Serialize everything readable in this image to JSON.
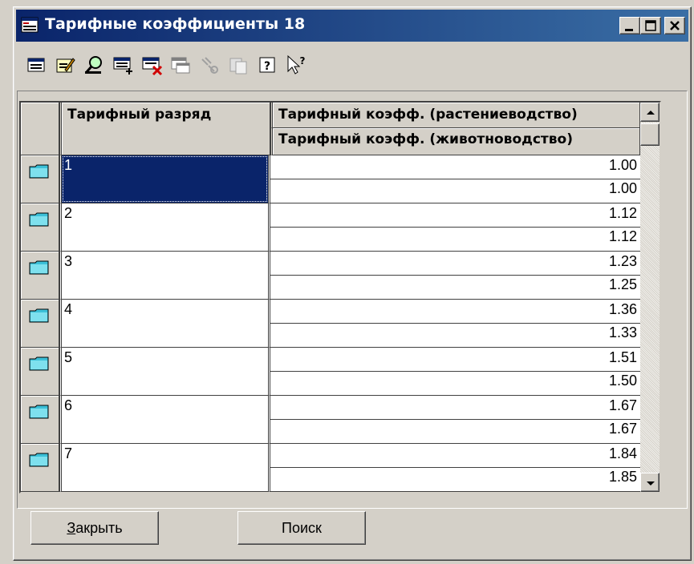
{
  "window": {
    "title": "Тарифные коэффициенты 18"
  },
  "toolbar": {
    "icons": [
      "record-icon",
      "edit-icon",
      "find-icon",
      "add-record-icon",
      "delete-record-icon",
      "copy-record-icon",
      "disabled-link-icon",
      "disabled-paste-icon",
      "help-icon",
      "context-help-icon"
    ]
  },
  "grid": {
    "columns": {
      "rank": "Тарифный разряд",
      "coef_crop": "Тарифный коэфф. (растениеводство)",
      "coef_livestock": "Тарифный коэфф. (животноводство)"
    },
    "rows": [
      {
        "rank": "1",
        "crop": "1.00",
        "livestock": "1.00",
        "selected": true
      },
      {
        "rank": "2",
        "crop": "1.12",
        "livestock": "1.12"
      },
      {
        "rank": "3",
        "crop": "1.23",
        "livestock": "1.25"
      },
      {
        "rank": "4",
        "crop": "1.36",
        "livestock": "1.33"
      },
      {
        "rank": "5",
        "crop": "1.51",
        "livestock": "1.50"
      },
      {
        "rank": "6",
        "crop": "1.67",
        "livestock": "1.67"
      },
      {
        "rank": "7",
        "crop": "1.84",
        "livestock": "1.85"
      }
    ]
  },
  "buttons": {
    "close_hotkey": "З",
    "close_rest": "акрыть",
    "search": "Поиск"
  },
  "colors": {
    "title_bar": "#0a246a",
    "selection": "#0a246a",
    "face": "#d4d0c8"
  }
}
